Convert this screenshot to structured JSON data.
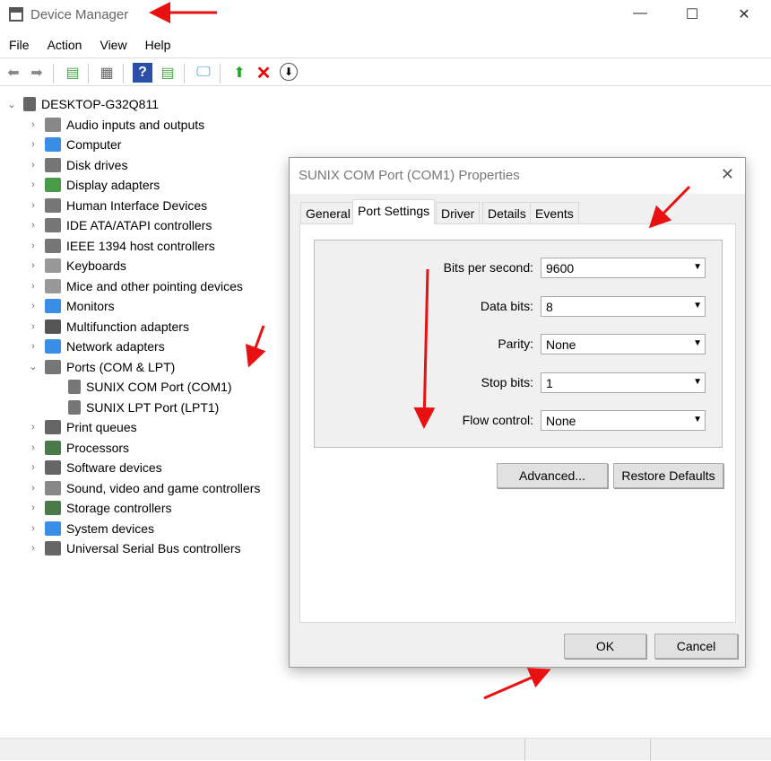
{
  "window": {
    "title": "Device Manager",
    "minimize": "—",
    "maximize": "☐",
    "close": "✕"
  },
  "menu": [
    "File",
    "Action",
    "View",
    "Help"
  ],
  "toolbar": [
    "back",
    "forward",
    "properties-pane",
    "properties",
    "help",
    "run",
    "scan-hardware",
    "update-driver",
    "uninstall",
    "disable"
  ],
  "tree": {
    "root": "DESKTOP-G32Q811",
    "items": [
      {
        "label": "Audio inputs and outputs",
        "color": "#888"
      },
      {
        "label": "Computer",
        "color": "#3a8ee6"
      },
      {
        "label": "Disk drives",
        "color": "#777"
      },
      {
        "label": "Display adapters",
        "color": "#4a9a4a"
      },
      {
        "label": "Human Interface Devices",
        "color": "#777"
      },
      {
        "label": "IDE ATA/ATAPI controllers",
        "color": "#777"
      },
      {
        "label": "IEEE 1394 host controllers",
        "color": "#777"
      },
      {
        "label": "Keyboards",
        "color": "#999"
      },
      {
        "label": "Mice and other pointing devices",
        "color": "#999"
      },
      {
        "label": "Monitors",
        "color": "#3a8ee6"
      },
      {
        "label": "Multifunction adapters",
        "color": "#555"
      },
      {
        "label": "Network adapters",
        "color": "#3a8ee6"
      },
      {
        "label": "Ports (COM & LPT)",
        "color": "#777",
        "expanded": true,
        "children": [
          "SUNIX COM Port (COM1)",
          "SUNIX LPT Port (LPT1)"
        ]
      },
      {
        "label": "Print queues",
        "color": "#666"
      },
      {
        "label": "Processors",
        "color": "#4a7a4a"
      },
      {
        "label": "Software devices",
        "color": "#666"
      },
      {
        "label": "Sound, video and game controllers",
        "color": "#888"
      },
      {
        "label": "Storage controllers",
        "color": "#4a7a4a"
      },
      {
        "label": "System devices",
        "color": "#3a8ee6"
      },
      {
        "label": "Universal Serial Bus controllers",
        "color": "#666"
      }
    ]
  },
  "dialog": {
    "title": "SUNIX COM Port (COM1) Properties",
    "close": "✕",
    "tabs": [
      "General",
      "Port Settings",
      "Driver",
      "Details",
      "Events"
    ],
    "active_tab": "Port Settings",
    "fields": [
      {
        "label": "Bits per second:",
        "value": "9600"
      },
      {
        "label": "Data bits:",
        "value": "8"
      },
      {
        "label": "Parity:",
        "value": "None"
      },
      {
        "label": "Stop bits:",
        "value": "1"
      },
      {
        "label": "Flow control:",
        "value": "None"
      }
    ],
    "advanced": "Advanced...",
    "restore": "Restore Defaults",
    "ok": "OK",
    "cancel": "Cancel"
  },
  "annotation_color": "#e81010"
}
